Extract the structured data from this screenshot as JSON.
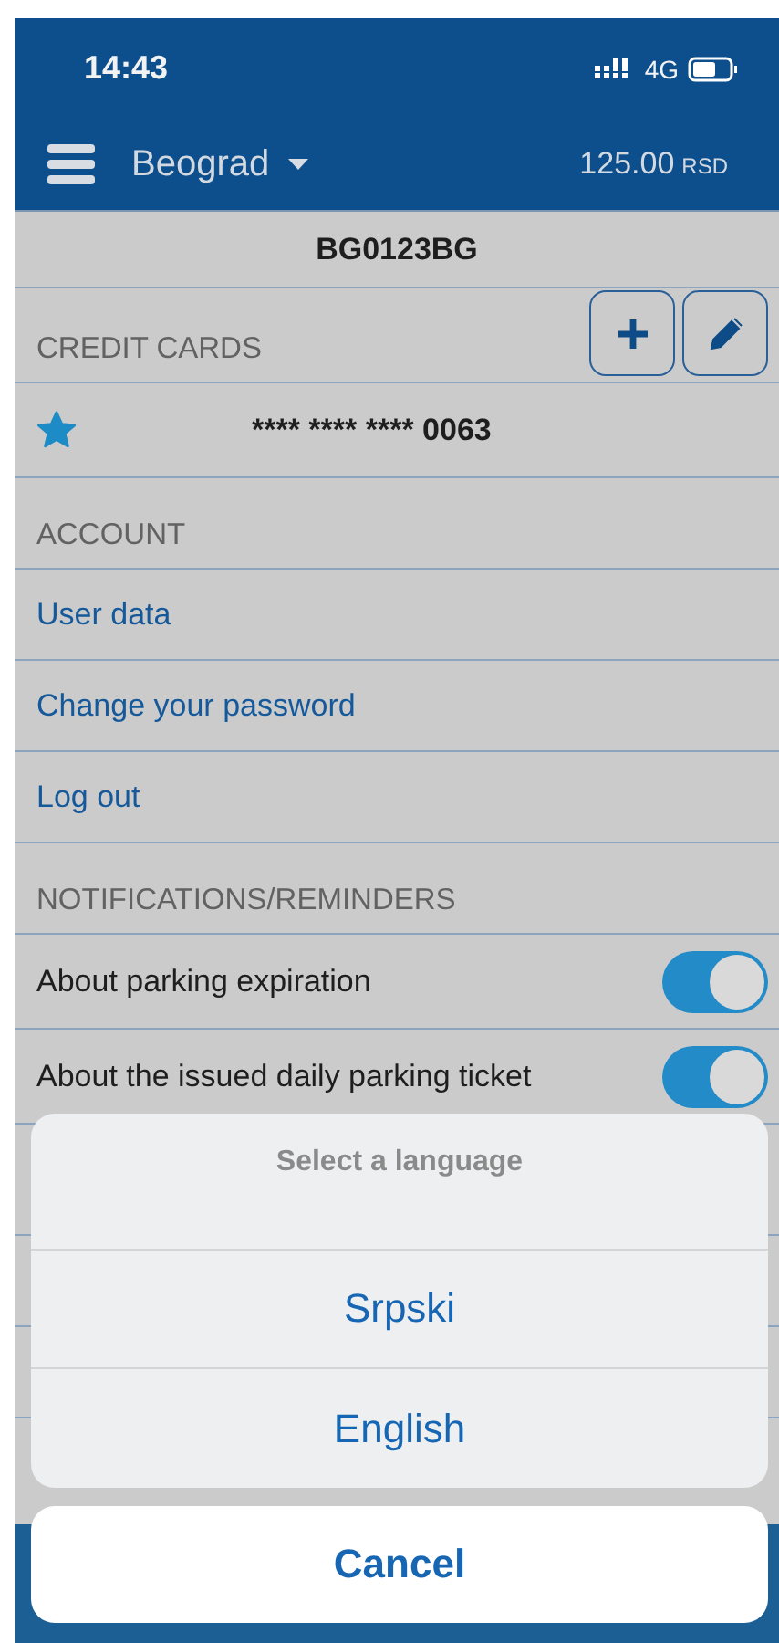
{
  "status_bar": {
    "time": "14:43",
    "network": "4G"
  },
  "header": {
    "city": "Beograd",
    "balance": "125.00",
    "currency": "RSD"
  },
  "plate": "BG0123BG",
  "credit_cards": {
    "title": "CREDIT CARDS",
    "cards": [
      {
        "number": "**** **** **** 0063",
        "favorite": true
      }
    ]
  },
  "account": {
    "title": "ACCOUNT",
    "items": [
      "User data",
      "Change your password",
      "Log out"
    ]
  },
  "notifications": {
    "title": "NOTIFICATIONS/REMINDERS",
    "items": [
      {
        "label": "About parking expiration",
        "on": true
      },
      {
        "label": "About the issued daily parking ticket",
        "on": true
      }
    ]
  },
  "action_sheet": {
    "title": "Select a language",
    "options": [
      "Srpski",
      "English"
    ],
    "cancel": "Cancel"
  }
}
